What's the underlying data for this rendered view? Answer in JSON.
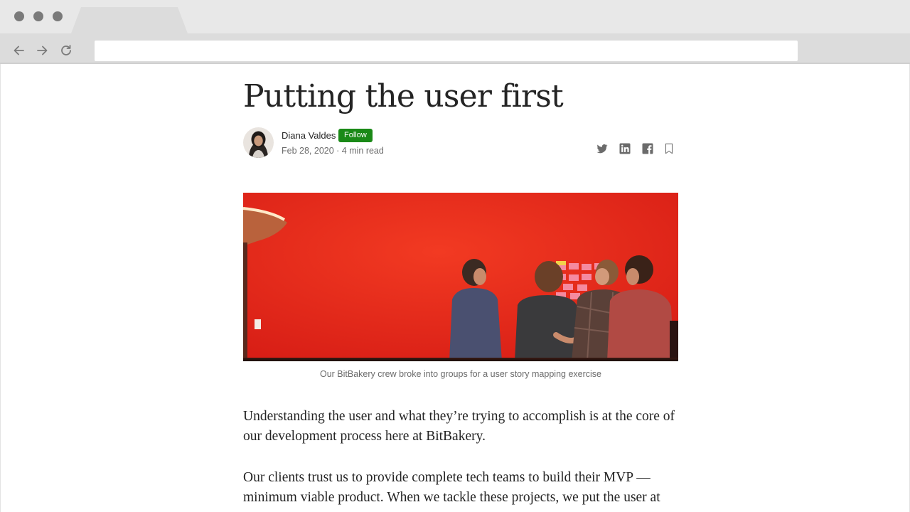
{
  "browser": {
    "url": "",
    "icons": {
      "back": "arrow-left-icon",
      "forward": "arrow-right-icon",
      "reload": "reload-icon"
    }
  },
  "article": {
    "title": "Putting the user first",
    "author": "Diana Valdes",
    "follow_label": "Follow",
    "meta": "Feb 28, 2020 · 4 min read",
    "share_icons": [
      "twitter-icon",
      "linkedin-icon",
      "facebook-icon",
      "bookmark-icon"
    ],
    "hero_caption": "Our BitBakery crew broke into groups for a user story mapping exercise",
    "paragraphs": [
      "Understanding the user and what they’re trying to accomplish is at the core of our development process here at BitBakery.",
      "Our clients trust us to provide complete tech teams to build their MVP — minimum viable product. When we tackle these projects, we put the user at"
    ]
  },
  "colors": {
    "follow_button": "#1a8917",
    "text": "#242424",
    "muted": "#6b6b6b",
    "hero_wall": "#e8241a"
  }
}
